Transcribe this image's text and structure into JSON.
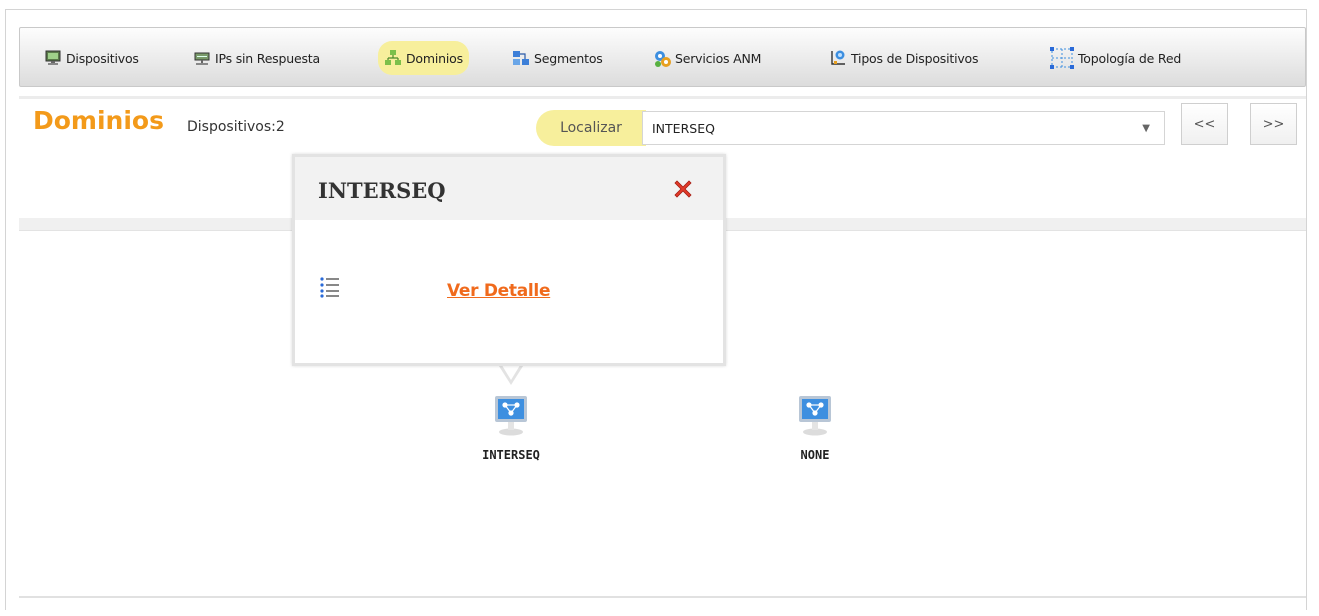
{
  "menu": {
    "items": [
      {
        "label": "Dispositivos",
        "icon": "monitor-icon"
      },
      {
        "label": "IPs sin Respuesta",
        "icon": "network-device-icon"
      },
      {
        "label": "Dominios",
        "icon": "domain-tree-icon",
        "active": true
      },
      {
        "label": "Segmentos",
        "icon": "segments-icon"
      },
      {
        "label": "Servicios ANM",
        "icon": "services-gear-icon"
      },
      {
        "label": "Tipos de Dispositivos",
        "icon": "device-types-icon"
      },
      {
        "label": "Topología de Red",
        "icon": "topology-icon"
      }
    ]
  },
  "header": {
    "title": "Dominios",
    "subtitle": "Dispositivos:2"
  },
  "locate": {
    "label": "Localizar",
    "selected": "INTERSEQ",
    "prev_label": "<<",
    "next_label": ">>"
  },
  "popup": {
    "title": "INTERSEQ",
    "link_label": "Ver Detalle"
  },
  "nodes": [
    {
      "label": "INTERSEQ"
    },
    {
      "label": "NONE"
    }
  ],
  "colors": {
    "accent_orange": "#f39a1a",
    "link_orange": "#f06a1c",
    "highlight_yellow": "#f7ef9c",
    "node_blue": "#3d8fe0"
  }
}
